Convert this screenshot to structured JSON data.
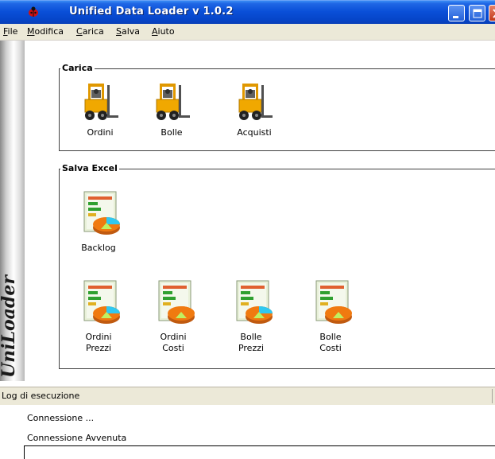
{
  "window": {
    "title": "Unified Data Loader v 1.0.2"
  },
  "menu": [
    {
      "label": "File",
      "accel": "F",
      "rest": "ile"
    },
    {
      "label": "Modifica",
      "accel": "M",
      "rest": "odifica"
    },
    {
      "label": "Carica",
      "accel": "C",
      "rest": "arica"
    },
    {
      "label": "Salva",
      "accel": "S",
      "rest": "alva"
    },
    {
      "label": "Aiuto",
      "accel": "A",
      "rest": "iuto"
    }
  ],
  "sidebar": {
    "brand": "UniLoader"
  },
  "carica": {
    "title": "Carica",
    "items": [
      {
        "label": "Ordini",
        "icon": "forklift-icon"
      },
      {
        "label": "Bolle",
        "icon": "forklift-icon"
      },
      {
        "label": "Acquisti",
        "icon": "forklift-icon"
      }
    ]
  },
  "salva": {
    "title": "Salva Excel",
    "backlog": {
      "label": "Backlog",
      "icon": "excel-report-icon"
    },
    "items": [
      {
        "line1": "Ordini",
        "line2": "Prezzi",
        "icon": "excel-report-icon"
      },
      {
        "line1": "Ordini",
        "line2": "Costi",
        "icon": "excel-report-icon"
      },
      {
        "line1": "Bolle",
        "line2": "Prezzi",
        "icon": "excel-report-icon"
      },
      {
        "line1": "Bolle",
        "line2": "Costi",
        "icon": "excel-report-icon"
      }
    ]
  },
  "log": {
    "title": "Log di esecuzione",
    "lines": [
      "Connessione ...",
      "Connessione Avvenuta"
    ]
  },
  "colors": {
    "titlebar": "#0a4fd8",
    "menubar": "#ece9d8",
    "forklift": "#f0a000",
    "report_orange": "#f07a10",
    "report_cyan": "#30c8f0"
  }
}
